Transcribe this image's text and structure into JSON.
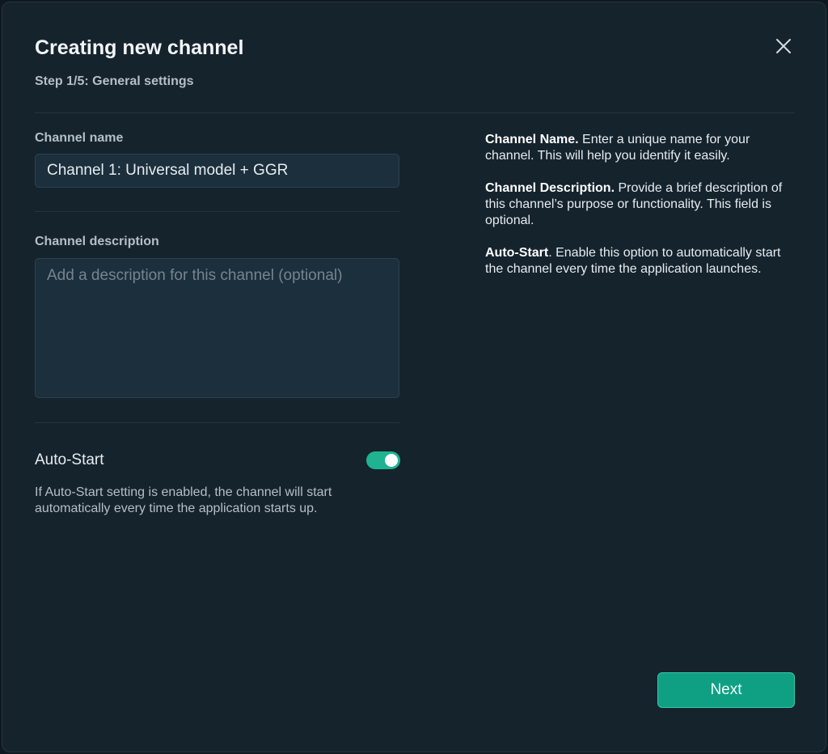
{
  "dialog": {
    "title": "Creating new channel",
    "step": "Step 1/5: General settings",
    "close_icon": "close-icon"
  },
  "form": {
    "channel_name_label": "Channel name",
    "channel_name_value": "Channel 1: Universal model + GGR",
    "channel_description_label": "Channel description",
    "channel_description_placeholder": "Add a description for this channel (optional)",
    "channel_description_value": "",
    "autostart_label": "Auto-Start",
    "autostart_enabled": true,
    "autostart_description": "If Auto-Start setting is enabled, the channel will start automatically every time the application starts up."
  },
  "help": {
    "name_title": "Channel Name.",
    "name_text": " Enter a unique name for your channel. This will help you identify it easily.",
    "description_title": "Channel Description.",
    "description_text": " Provide a brief description of this channel’s purpose or functionality. This field is optional.",
    "autostart_title": "Auto-Start",
    "autostart_text": ". Enable this option to automatically start the channel every time the application launches."
  },
  "footer": {
    "next_label": "Next"
  },
  "colors": {
    "background": "#15232d",
    "accent": "#0fa084",
    "toggle_on": "#1fb392"
  }
}
